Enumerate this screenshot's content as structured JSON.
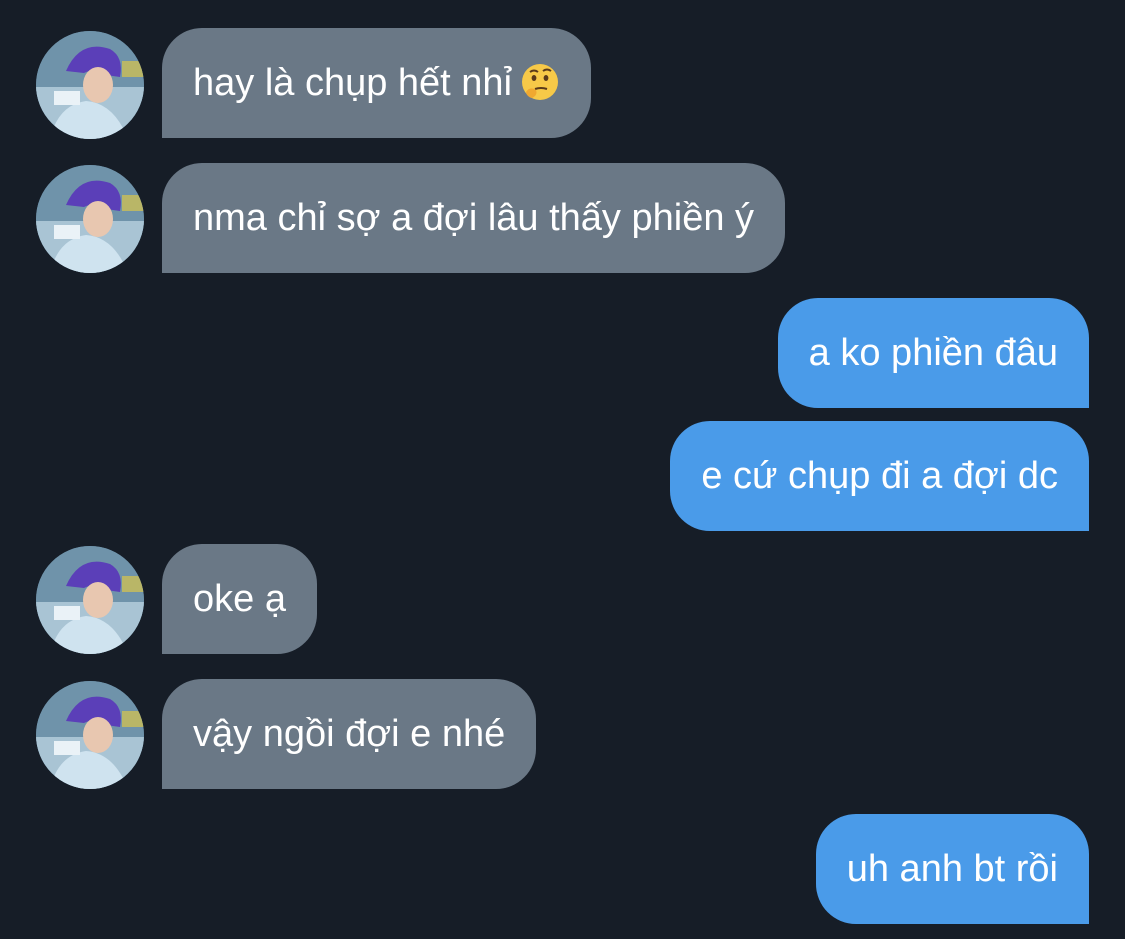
{
  "messages": [
    {
      "from": "other",
      "text": "hay là chụp hết nhỉ",
      "emoji": "thinking-face-icon"
    },
    {
      "from": "other",
      "text": "nma chỉ sợ a đợi lâu thấy phiền ý"
    },
    {
      "from": "me",
      "text": "a ko phiền đâu"
    },
    {
      "from": "me",
      "text": "e cứ chụp đi a đợi dc"
    },
    {
      "from": "other",
      "text": "oke ạ"
    },
    {
      "from": "other",
      "text": "vậy ngồi đợi e nhé"
    },
    {
      "from": "me",
      "text": "uh anh bt rồi"
    }
  ],
  "colors": {
    "background": "#161d27",
    "incoming_bubble": "#6a7886",
    "outgoing_bubble": "#4a9be9",
    "text": "#ffffff"
  }
}
